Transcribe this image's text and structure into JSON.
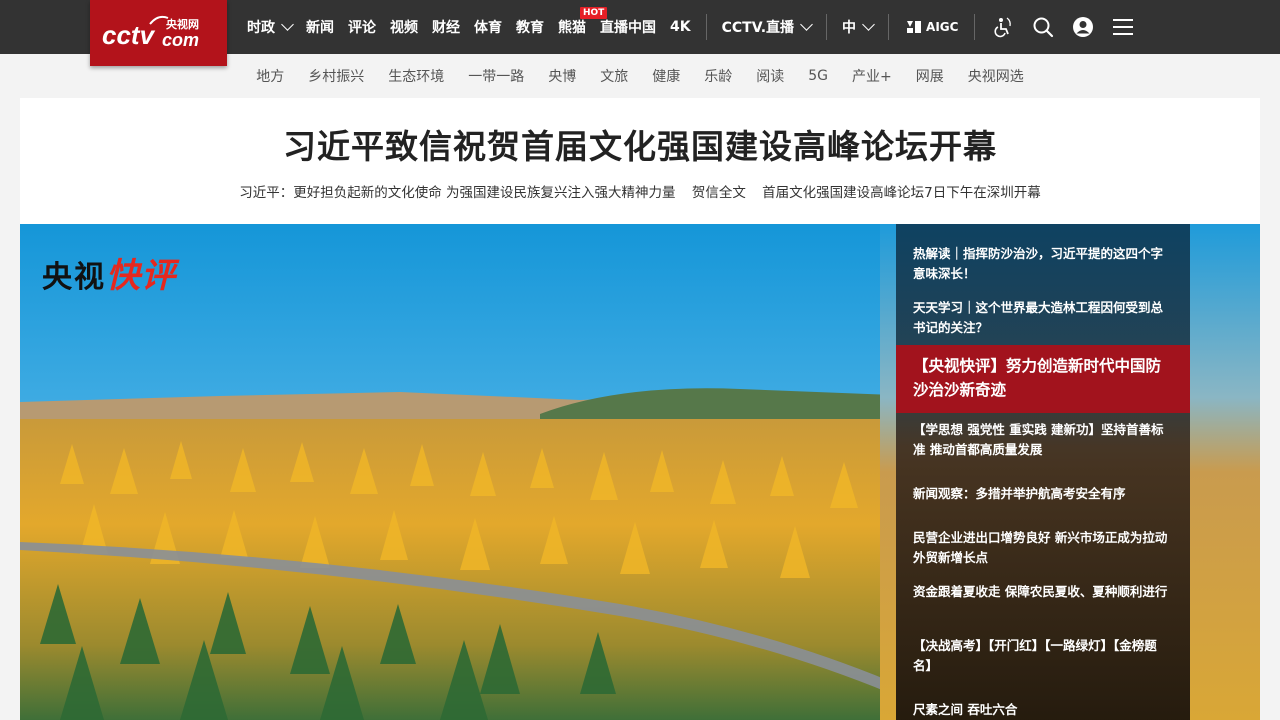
{
  "logo": {
    "brand": "CCTV.com",
    "cn": "央视网"
  },
  "nav": {
    "items": [
      {
        "label": "时政",
        "dropdown": true
      },
      {
        "label": "新闻"
      },
      {
        "label": "评论"
      },
      {
        "label": "视频"
      },
      {
        "label": "财经"
      },
      {
        "label": "体育"
      },
      {
        "label": "教育"
      },
      {
        "label": "熊猫",
        "badge": "HOT"
      },
      {
        "label": "直播中国"
      },
      {
        "label": "4K"
      }
    ],
    "live": "CCTV.直播",
    "lang": "中",
    "aigc": "AIGC",
    "icons": [
      "accessibility-icon",
      "search-icon",
      "user-icon",
      "menu-icon"
    ]
  },
  "subnav": [
    "地方",
    "乡村振兴",
    "生态环境",
    "一带一路",
    "央博",
    "文旅",
    "健康",
    "乐龄",
    "阅读",
    "5G",
    "产业+",
    "网展",
    "央视网选"
  ],
  "headline": {
    "title": "习近平致信祝贺首届文化强国建设高峰论坛开幕",
    "links": [
      "习近平：更好担负起新的文化使命 为强国建设民族复兴注入强大精神力量",
      "贺信全文",
      "首届文化强国建设高峰论坛7日下午在深圳开幕"
    ]
  },
  "hero": {
    "badge_a": "央视",
    "badge_b": "快评",
    "side_items": [
      "热解读｜指挥防沙治沙，习近平提的这四个字意味深长！",
      "天天学习｜这个世界最大造林工程因何受到总书记的关注？",
      "【央视快评】努力创造新时代中国防沙治沙新奇迹",
      "【学思想 强党性 重实践 建新功】坚持首善标准 推动首都高质量发展",
      "新闻观察：多措并举护航高考安全有序",
      "民营企业进出口增势良好 新兴市场正成为拉动外贸新增长点",
      "资金跟着夏收走 保障农民夏收、夏种顺利进行",
      "【决战高考】【开门红】【一路绿灯】【金榜题名】",
      "尺素之间 吞吐六合"
    ],
    "active_index": 2
  },
  "colors": {
    "topbar": "#333333",
    "brand_red": "#b3131b",
    "active_red": "#a2131d",
    "hot": "#e61f26"
  }
}
